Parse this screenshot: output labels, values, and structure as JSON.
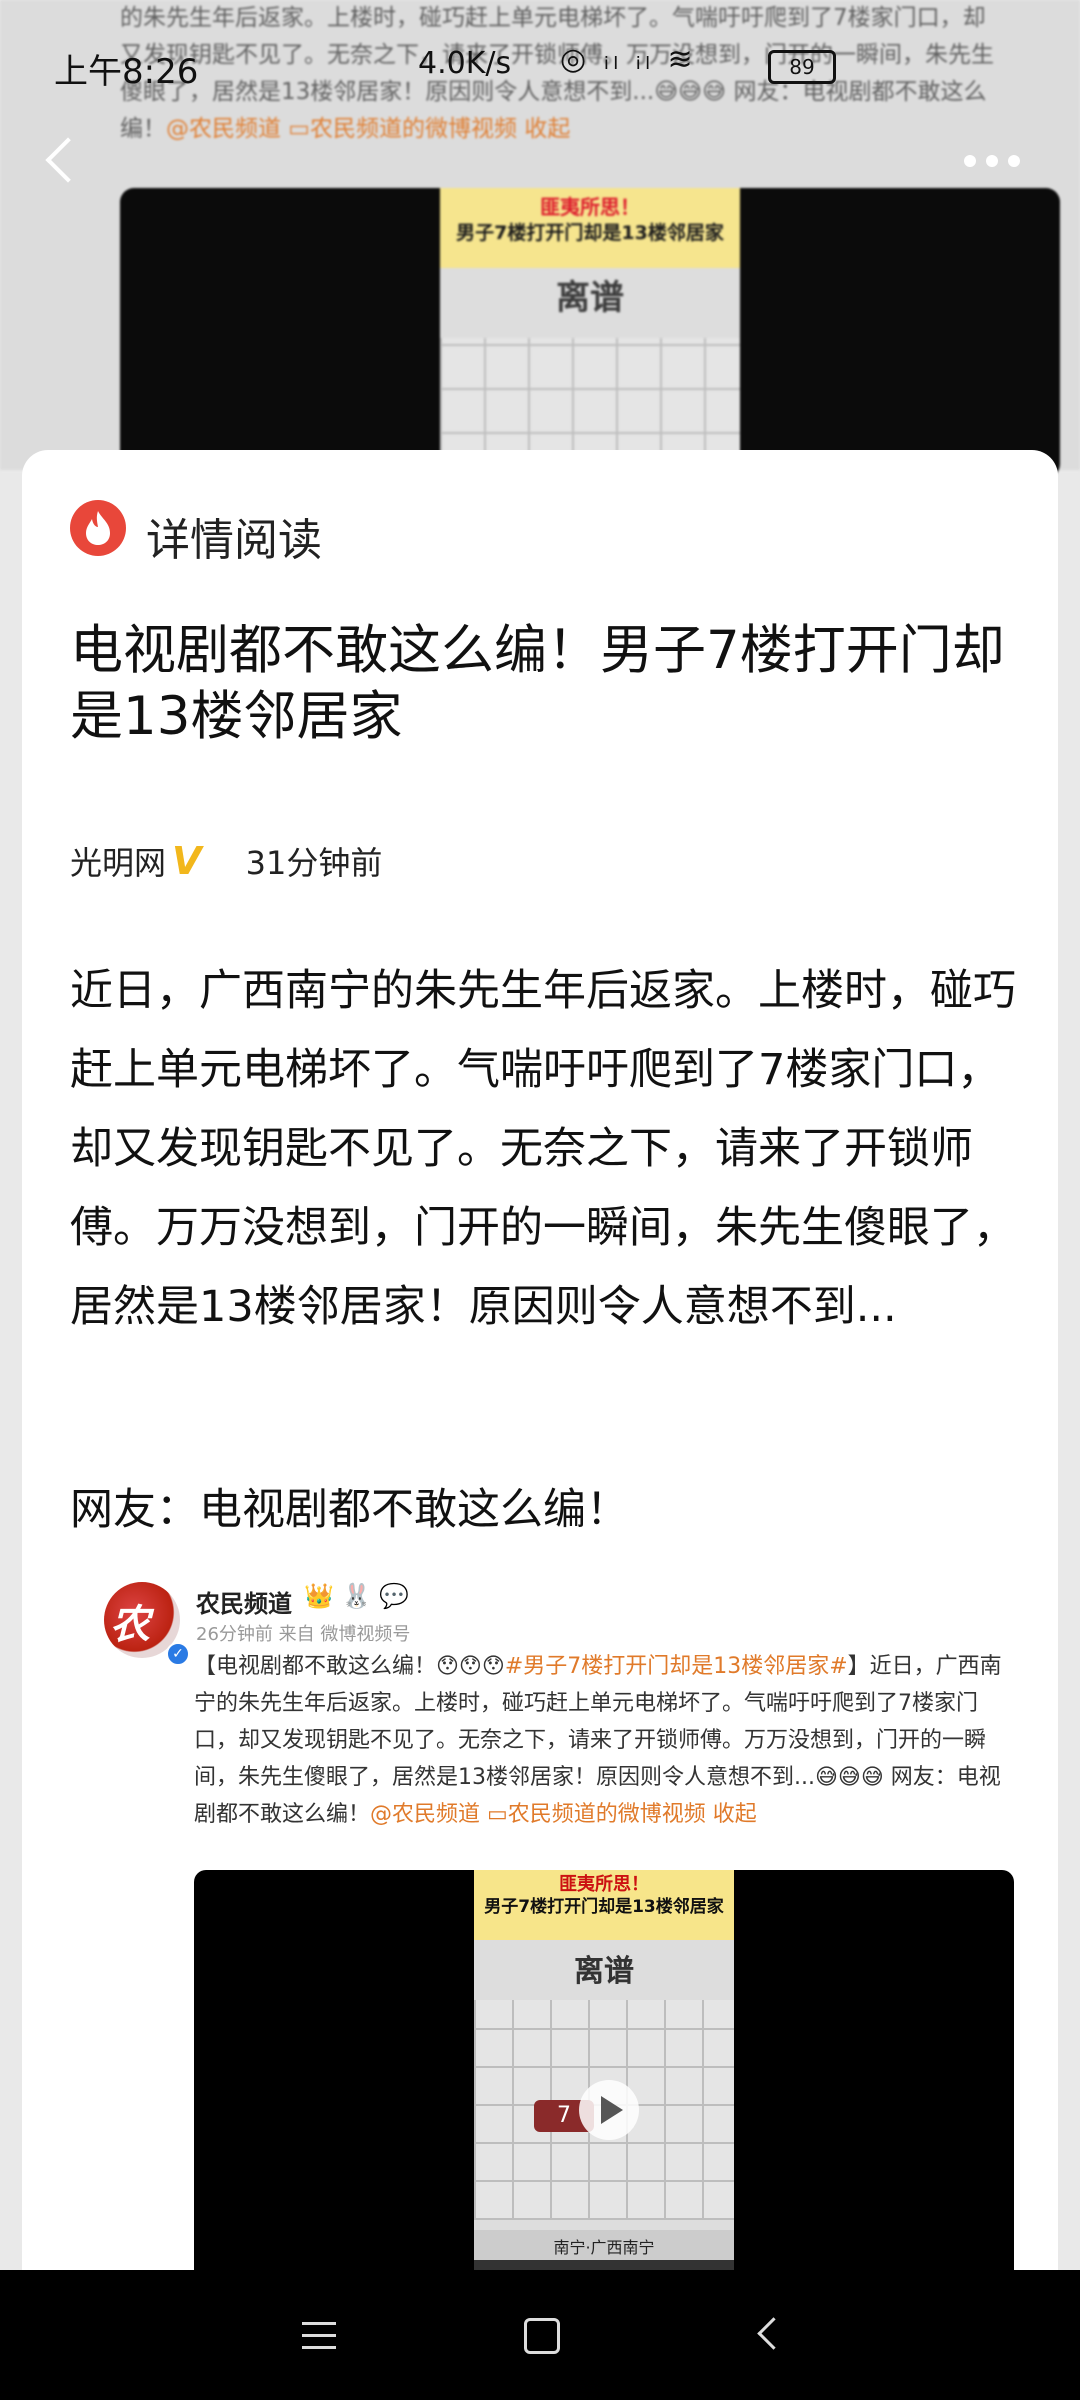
{
  "status_bar": {
    "time": "上午8:26",
    "net_speed": "4.0K/s",
    "icons": "◎ ᵢₗ ᵢₗ ≋",
    "battery": "89"
  },
  "background": {
    "text_lines": [
      "的朱先生年后返家。上楼时，碰巧赶上单元电梯坏了。气喘吁吁爬到了7楼家门口，却",
      "又发现钥匙不见了。无奈之下，请来了开锁师傅。万万没想到，门开的一瞬间，朱先生",
      "傻眼了，居然是13楼邻居家！原因则令人意想不到...😅😅😅 网友：电视剧都不敢这么",
      "编！"
    ],
    "links": "@农民频道 ▭农民频道的微博视频 收起",
    "video_banner_line1": "匪夷所思！",
    "video_banner_line2": "男子7楼打开门却是13楼邻居家",
    "video_title": "离谱"
  },
  "card": {
    "header_title": "详情阅读",
    "article_title": "电视剧都不敢这么编！男子7楼打开门却是13楼邻居家",
    "source": "光明网",
    "verified_mark": "V",
    "time_ago": "31分钟前",
    "body": "近日，广西南宁的朱先生年后返家。上楼时，碰巧赶上单元电梯坏了。气喘吁吁爬到了7楼家门口，却又发现钥匙不见了。无奈之下，请来了开锁师傅。万万没想到，门开的一瞬间，朱先生傻眼了，居然是13楼邻居家！原因则令人意想不到...",
    "quote": "网友：电视剧都不敢这么编！"
  },
  "embed": {
    "avatar_char": "农",
    "name": "农民频道",
    "name_emojis": "👑 🐰 💬",
    "meta": "26分钟前 来自 微博视频号",
    "text_intro": "【电视剧都不敢这么编！😯😯😯",
    "text_hashtag": "#男子7楼打开门却是13楼邻居家#",
    "text_rest": "】近日，广西南宁的朱先生年后返家。上楼时，碰巧赶上单元电梯坏了。气喘吁吁爬到了7楼家门口，却又发现钥匙不见了。无奈之下，请来了开锁师傅。万万没想到，门开的一瞬间，朱先生傻眼了，居然是13楼邻居家！原因则令人意想不到...😅😅😅 网友：电视剧都不敢这么编！",
    "text_links": "@农民频道 ▭农民频道的微博视频 收起",
    "video_banner_line1": "匪夷所思！",
    "video_banner_line2": "男子7楼打开门却是13楼邻居家",
    "video_title": "离谱",
    "floor_label": "7",
    "caption": "南宁·广西南宁"
  },
  "colors": {
    "accent_orange": "#e07a2a",
    "fire_red": "#e8473a",
    "verified_gold": "#f2b71c"
  }
}
